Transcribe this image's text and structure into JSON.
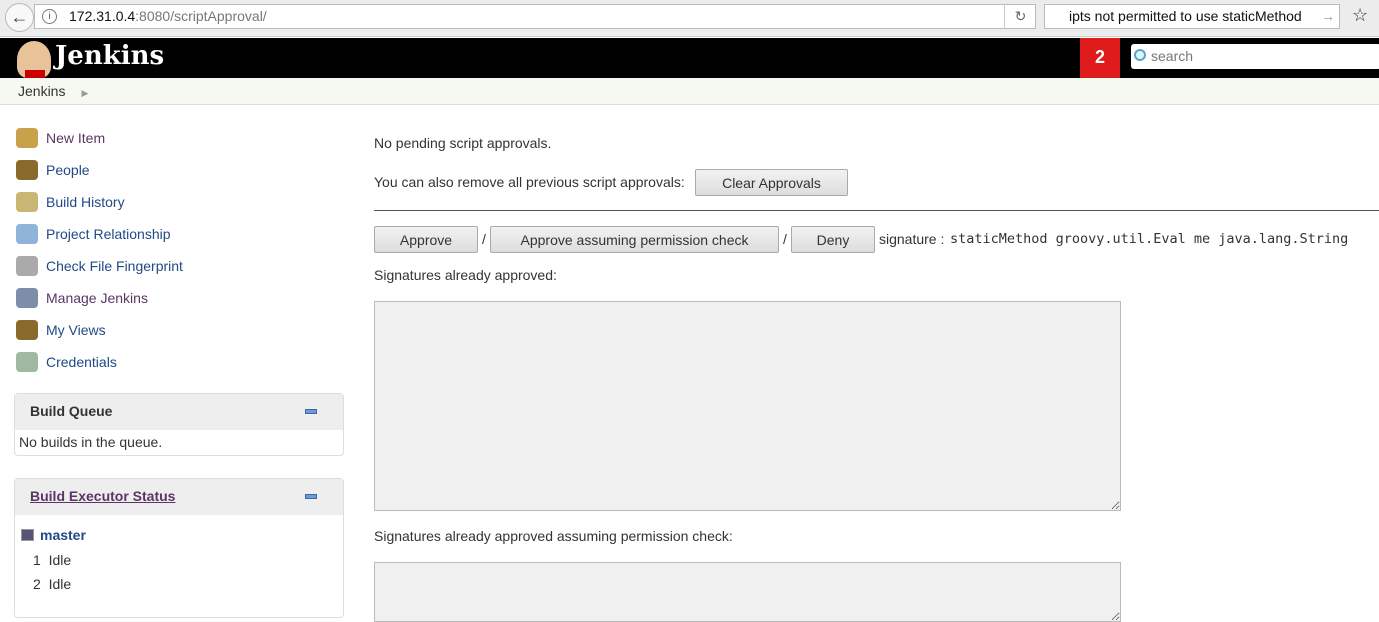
{
  "browser": {
    "url_host": "172.31.0.4",
    "url_rest": ":8080/scriptApproval/",
    "find_text": "ipts not permitted to use staticMethod"
  },
  "header": {
    "brand": "Jenkins",
    "notification_count": "2",
    "search_placeholder": "search"
  },
  "breadcrumb": {
    "root": "Jenkins"
  },
  "sidebar": {
    "items": [
      {
        "label": "New Item",
        "icon": "new-item-icon",
        "color": "#c8a24a"
      },
      {
        "label": "People",
        "icon": "people-icon",
        "color": "#8a6a2a"
      },
      {
        "label": "Build History",
        "icon": "notepad-icon",
        "color": "#c9b673"
      },
      {
        "label": "Project Relationship",
        "icon": "magnifier-icon",
        "color": "#8fb3d9"
      },
      {
        "label": "Check File Fingerprint",
        "icon": "fingerprint-icon",
        "color": "#aaaaaa"
      },
      {
        "label": "Manage Jenkins",
        "icon": "gear-icon",
        "color": "#7d8ea8"
      },
      {
        "label": "My Views",
        "icon": "people-icon",
        "color": "#8a6a2a"
      },
      {
        "label": "Credentials",
        "icon": "keys-icon",
        "color": "#a0b8a0"
      }
    ],
    "build_queue": {
      "title": "Build Queue",
      "empty": "No builds in the queue."
    },
    "executors": {
      "title": "Build Executor Status",
      "node": "master",
      "rows": [
        {
          "n": "1",
          "status": "Idle"
        },
        {
          "n": "2",
          "status": "Idle"
        }
      ]
    }
  },
  "main": {
    "no_pending": "No pending script approvals.",
    "remove_text": "You can also remove all previous script approvals:",
    "clear_btn": "Clear Approvals",
    "approve_btn": "Approve",
    "sep": "/",
    "approve_perm_btn": "Approve assuming permission check",
    "deny_btn": "Deny",
    "sig_label": "signature : ",
    "signature": "staticMethod groovy.util.Eval me java.lang.String",
    "approved_label": "Signatures already approved:",
    "approved_perm_label": "Signatures already approved assuming permission check:"
  }
}
